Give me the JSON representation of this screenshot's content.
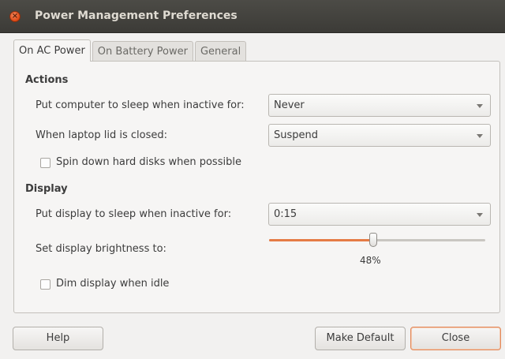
{
  "window": {
    "title": "Power Management Preferences"
  },
  "tabs": [
    {
      "label": "On AC Power",
      "active": true
    },
    {
      "label": "On Battery Power",
      "active": false
    },
    {
      "label": "General",
      "active": false
    }
  ],
  "actions": {
    "heading": "Actions",
    "sleep_label": "Put computer to sleep when inactive for:",
    "sleep_value": "Never",
    "lid_label": "When laptop lid is closed:",
    "lid_value": "Suspend",
    "spin_down_label": "Spin down hard disks when possible",
    "spin_down_checked": false
  },
  "display": {
    "heading": "Display",
    "display_sleep_label": "Put display to sleep when inactive for:",
    "display_sleep_value": "0:15",
    "brightness_label": "Set display brightness to:",
    "brightness_value": 48,
    "brightness_text": "48%",
    "dim_label": "Dim display when idle",
    "dim_checked": false
  },
  "buttons": {
    "help": "Help",
    "make_default": "Make Default",
    "close": "Close"
  },
  "colors": {
    "accent": "#e57b45",
    "titlebar": "#3c3b37",
    "close_button": "#dd4814"
  }
}
